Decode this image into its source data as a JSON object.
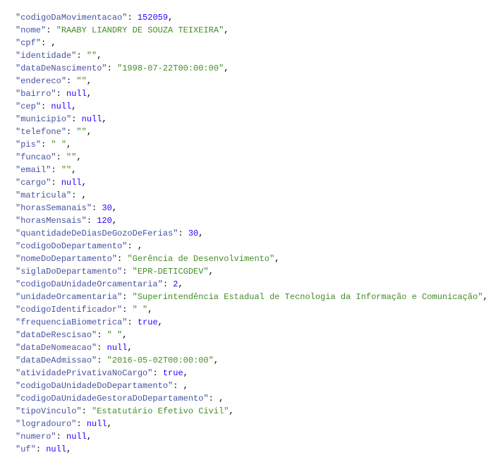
{
  "rows": [
    {
      "key": "codigoDaMovimentacao",
      "type": "num",
      "value": "152059",
      "trailing": ","
    },
    {
      "key": "nome",
      "type": "str",
      "value": "RAABY LIANDRY DE SOUZA TEIXEIRA",
      "trailing": ","
    },
    {
      "key": "cpf",
      "type": "blank",
      "value": "               ",
      "trailing": ","
    },
    {
      "key": "identidade",
      "type": "str",
      "value": "",
      "trailing": ","
    },
    {
      "key": "dataDeNascimento",
      "type": "str",
      "value": "1998-07-22T00:00:00",
      "trailing": ","
    },
    {
      "key": "endereco",
      "type": "str",
      "value": "",
      "trailing": ","
    },
    {
      "key": "bairro",
      "type": "lit",
      "value": "null",
      "trailing": ","
    },
    {
      "key": "cep",
      "type": "lit",
      "value": "null",
      "trailing": ","
    },
    {
      "key": "municipio",
      "type": "lit",
      "value": "null",
      "trailing": ","
    },
    {
      "key": "telefone",
      "type": "str",
      "value": "",
      "trailing": ","
    },
    {
      "key": "pis",
      "type": "blankstr",
      "value": "             ",
      "trailing": ","
    },
    {
      "key": "funcao",
      "type": "str",
      "value": "",
      "trailing": ","
    },
    {
      "key": "email",
      "type": "str",
      "value": "",
      "trailing": ","
    },
    {
      "key": "cargo",
      "type": "lit",
      "value": "null",
      "trailing": ","
    },
    {
      "key": "matricula",
      "type": "blank",
      "value": "             ",
      "trailing": ","
    },
    {
      "key": "horasSemanais",
      "type": "num",
      "value": "30",
      "trailing": ","
    },
    {
      "key": "horasMensais",
      "type": "num",
      "value": "120",
      "trailing": ","
    },
    {
      "key": "quantidadeDeDiasDeGozoDeFerias",
      "type": "num",
      "value": "30",
      "trailing": ","
    },
    {
      "key": "codigoDoDepartamento",
      "type": "blank",
      "value": "     ",
      "trailing": ","
    },
    {
      "key": "nomeDoDepartamento",
      "type": "str",
      "value": "Gerência de Desenvolvimento",
      "trailing": ","
    },
    {
      "key": "siglaDoDepartamento",
      "type": "str",
      "value": "EPR-DETICGDEV",
      "trailing": ","
    },
    {
      "key": "codigoDaUnidadeOrcamentaria",
      "type": "num",
      "value": "2",
      "trailing": ","
    },
    {
      "key": "unidadeOrcamentaria",
      "type": "str",
      "value": "Superintendência Estadual de Tecnologia da Informação e Comunicação",
      "trailing": ","
    },
    {
      "key": "codigoIdentificador",
      "type": "blankstr",
      "value": "       ",
      "trailing": ","
    },
    {
      "key": "frequenciaBiometrica",
      "type": "lit",
      "value": "true",
      "trailing": ","
    },
    {
      "key": "dataDeRescisao",
      "type": "blankstr",
      "value": "                   ",
      "trailing": ","
    },
    {
      "key": "dataDeNomeacao",
      "type": "lit",
      "value": "null",
      "trailing": ","
    },
    {
      "key": "dataDeAdmissao",
      "type": "str",
      "value": "2016-05-02T00:00:00",
      "trailing": ","
    },
    {
      "key": "atividadePrivativaNoCargo",
      "type": "lit",
      "value": "true",
      "trailing": ","
    },
    {
      "key": "codigoDaUnidadeDoDepartamento",
      "type": "blank",
      "value": "   ",
      "trailing": ","
    },
    {
      "key": "codigoDaUnidadeGestoraDoDepartamento",
      "type": "blank",
      "value": "   ",
      "trailing": ","
    },
    {
      "key": "tipoVinculo",
      "type": "str",
      "value": "Estatutário Efetivo Civil",
      "trailing": ","
    },
    {
      "key": "logradouro",
      "type": "lit",
      "value": "null",
      "trailing": ","
    },
    {
      "key": "numero",
      "type": "lit",
      "value": "null",
      "trailing": ","
    },
    {
      "key": "uf",
      "type": "lit",
      "value": "null",
      "trailing": ","
    }
  ]
}
